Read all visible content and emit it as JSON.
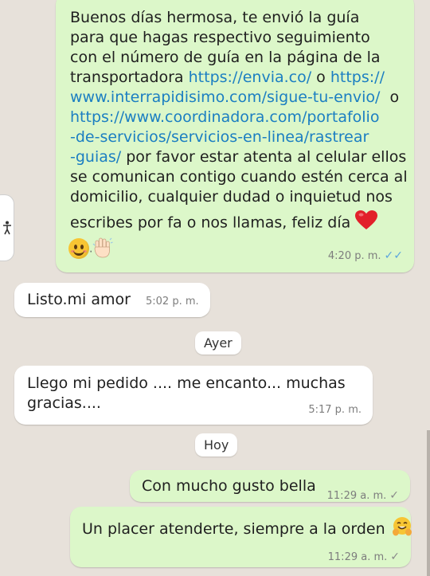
{
  "messages": [
    {
      "direction": "outgoing",
      "lines": [
        [
          {
            "t": "Buenos días hermosa, te envió la guía"
          }
        ],
        [
          {
            "t": "para que hagas respectivo seguimiento"
          }
        ],
        [
          {
            "t": "con el número de guía en la página de la"
          }
        ],
        [
          {
            "t": "transportadora "
          },
          {
            "t": "https://envia.co/",
            "link": true
          },
          {
            "t": " o "
          },
          {
            "t": "https://",
            "link": true
          }
        ],
        [
          {
            "t": "www.interrapidisimo.com/sigue-tu-envio/",
            "link": true
          },
          {
            "t": "  o"
          }
        ],
        [
          {
            "t": "https://www.coordinadora.com/portafolio",
            "link": true
          }
        ],
        [
          {
            "t": "-de-servicios/servicios-en-linea/rastrear",
            "link": true
          }
        ],
        [
          {
            "t": "-guias/",
            "link": true
          },
          {
            "t": " por favor estar atenta al celular ellos"
          }
        ],
        [
          {
            "t": "se comunican contigo cuando estén cerca al"
          }
        ],
        [
          {
            "t": "domicilio, cualquier dudad o inquietud nos"
          }
        ],
        [
          {
            "t": "escribes por fa o nos llamas, feliz día"
          }
        ]
      ],
      "trailing_emoji": "red-heart",
      "extra_emojis": [
        "smiling-face",
        "waving-hand"
      ],
      "time": "4:20 p. m.",
      "status": "read"
    },
    {
      "direction": "incoming",
      "text": "Listo.mi amor",
      "time": "5:02 p. m."
    },
    {
      "direction": "incoming",
      "text": "Llego mi pedido .... me encanto... muchas gracias....",
      "time": "5:17 p. m."
    },
    {
      "direction": "outgoing",
      "text": "Con mucho gusto bella",
      "time": "11:29 a. m.",
      "status": "delivered"
    },
    {
      "direction": "outgoing",
      "text": "Un placer atenderte, siempre a la orden",
      "emoji": "hugging-face",
      "time": "11:29 a. m.",
      "status": "delivered"
    }
  ],
  "day_separators": [
    "Ayer",
    "Hoy"
  ],
  "icons": {
    "side_tab": "accessibility-icon",
    "read_ticks": "double-check-icon",
    "sent_tick": "check-icon"
  },
  "colors": {
    "chat_background": "#e7e1da",
    "outgoing_bubble": "#dcf7c9",
    "incoming_bubble": "#ffffff",
    "link": "#1b7ec2",
    "read_ticks": "#5aa5dd"
  }
}
